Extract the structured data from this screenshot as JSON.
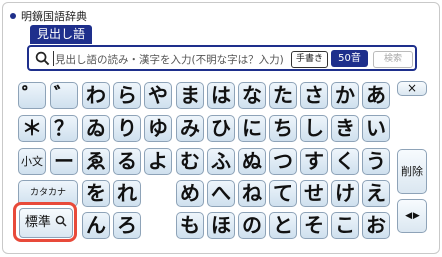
{
  "dictionary_title": "明鏡国語辞典",
  "search_tab": "見出し語",
  "search": {
    "placeholder": "見出し語の読み・漢字を入力(不明な字は？入力)",
    "handwriting_label": "手書き",
    "mode_label": "50音",
    "search_label": "検索"
  },
  "keys": {
    "row1": [
      "゜",
      "゛",
      "わ",
      "ら",
      "や",
      "ま",
      "は",
      "な",
      "た",
      "さ",
      "か",
      "あ"
    ],
    "row2": [
      "＊",
      "？",
      "ゐ",
      "り",
      "ゆ",
      "み",
      "ひ",
      "に",
      "ち",
      "し",
      "き",
      "い"
    ],
    "row3": [
      "小文字",
      "ー",
      "ゑ",
      "る",
      "よ",
      "む",
      "ふ",
      "ぬ",
      "つ",
      "す",
      "く",
      "う"
    ],
    "row4": [
      "カタカナ",
      "を",
      "れ",
      "め",
      "へ",
      "ね",
      "て",
      "せ",
      "け",
      "え"
    ],
    "row5": [
      "ん",
      "ろ",
      "も",
      "ほ",
      "の",
      "と",
      "そ",
      "こ",
      "お"
    ]
  },
  "side": {
    "close_label": "×",
    "delete_label": "削除",
    "cursor_label": "◀ ▶"
  },
  "standard_button_label": "標準"
}
